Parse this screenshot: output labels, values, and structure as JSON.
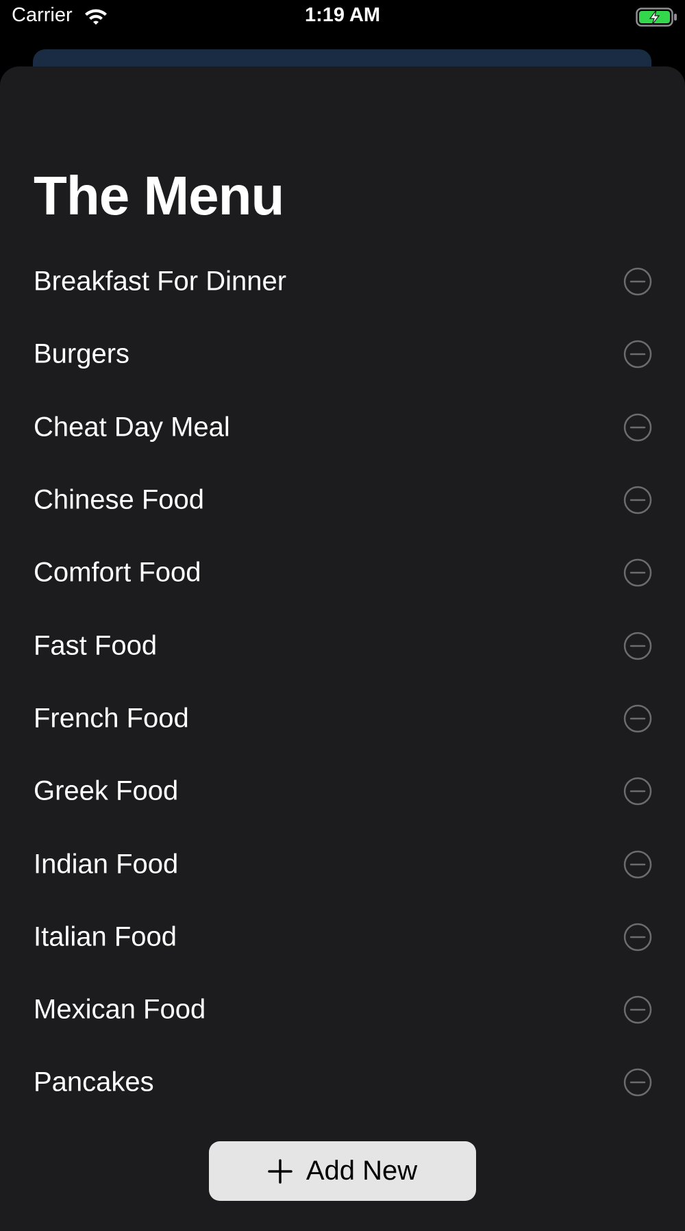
{
  "status_bar": {
    "carrier": "Carrier",
    "time": "1:19 AM",
    "wifi_icon": "wifi-icon",
    "battery_icon": "battery-charging-icon",
    "battery_color": "#32d74b"
  },
  "screen": {
    "title": "The Menu",
    "remove_icon": "minus-circle-icon",
    "items": [
      {
        "label": "Breakfast For Dinner"
      },
      {
        "label": "Burgers"
      },
      {
        "label": "Cheat Day Meal"
      },
      {
        "label": "Chinese Food"
      },
      {
        "label": "Comfort Food"
      },
      {
        "label": "Fast Food"
      },
      {
        "label": "French Food"
      },
      {
        "label": "Greek Food"
      },
      {
        "label": "Indian Food"
      },
      {
        "label": "Italian Food"
      },
      {
        "label": "Mexican Food"
      },
      {
        "label": "Pancakes"
      }
    ]
  },
  "add_button": {
    "label": "Add New",
    "icon": "plus-icon"
  },
  "colors": {
    "background": "#000000",
    "sheet": "#1c1c1e",
    "behind_card": "#1a2b44",
    "button_bg": "#e5e5e5",
    "remove_icon": "#6b6b70"
  }
}
